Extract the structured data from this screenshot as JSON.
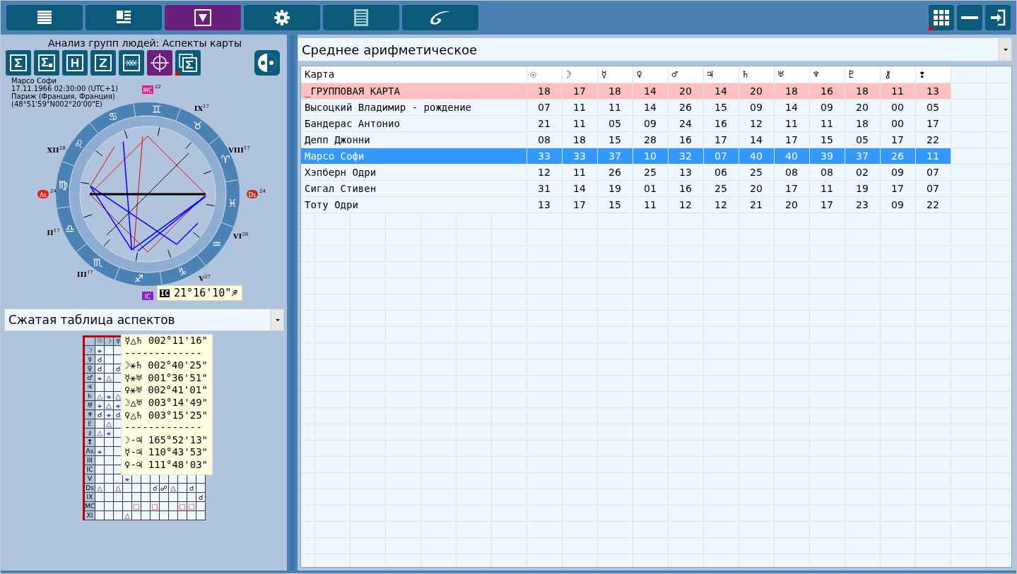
{
  "top_tabs": [
    {
      "selected": false
    },
    {
      "selected": false
    },
    {
      "selected": true
    },
    {
      "selected": false
    },
    {
      "selected": false
    },
    {
      "selected": false
    }
  ],
  "window_buttons": [
    {
      "marked": true
    },
    {
      "marked": false
    },
    {
      "marked": false
    }
  ],
  "left_panel": {
    "title": "Анализ групп людей: Аспекты карты",
    "tools": [
      {
        "selected": false,
        "marked": false
      },
      {
        "selected": false,
        "marked": false
      },
      {
        "selected": false,
        "marked": false
      },
      {
        "selected": false,
        "marked": false
      },
      {
        "selected": false,
        "marked": false
      },
      {
        "selected": true,
        "marked": false
      },
      {
        "selected": false,
        "marked": true
      }
    ],
    "chart": {
      "info": [
        "Марсо Софи",
        "17.11.1966 02:30:00 (UTC+1)",
        "Париж (Франция, Франция)",
        "(48°51'59\"N002°20'00\"E)"
      ],
      "signs": [
        "♊",
        "♉",
        "♈",
        "♓",
        "♒",
        "♑",
        "♐",
        "♏",
        "♎",
        "♍",
        "♌",
        "♋"
      ],
      "houses": [
        {
          "label": "XII",
          "degree": "28"
        },
        {
          "label": "IX",
          "degree": "17"
        },
        {
          "label": "VIII",
          "degree": "17"
        },
        {
          "label": "VI",
          "degree": "28"
        },
        {
          "label": "V",
          "degree": "27"
        },
        {
          "label": "III",
          "degree": "17"
        },
        {
          "label": "II",
          "degree": "17"
        }
      ],
      "angles": [
        {
          "label": "MC",
          "degree": "22"
        },
        {
          "label": "As",
          "degree": "24"
        },
        {
          "label": "Ds",
          "degree": "24"
        },
        {
          "label": "IC"
        }
      ],
      "tooltip": {
        "label": "IC",
        "value": "21°16'10\"♐"
      }
    },
    "view_select": {
      "value": "Сжатая таблица аспектов"
    },
    "aspect_grid": {
      "columns": [
        "☉",
        "☽",
        "☿"
      ],
      "rows": [
        {
          "header": "☽",
          "cells": [
            {
              "kind": "harmonious",
              "glyph": "⚹"
            },
            {
              "kind": "empty"
            },
            {
              "kind": "empty"
            },
            {
              "kind": "empty"
            },
            {
              "kind": "empty"
            },
            {
              "kind": "empty"
            },
            {
              "kind": "empty"
            },
            {
              "kind": "empty"
            },
            {
              "kind": "empty"
            },
            {
              "kind": "empty"
            },
            {
              "kind": "empty"
            },
            {
              "kind": "empty"
            }
          ]
        },
        {
          "header": "☿",
          "cells": [
            {
              "kind": "neutral",
              "glyph": "☌"
            },
            {
              "kind": "empty"
            },
            {
              "kind": "empty"
            },
            {
              "kind": "empty"
            },
            {
              "kind": "empty"
            },
            {
              "kind": "empty"
            },
            {
              "kind": "empty"
            },
            {
              "kind": "empty"
            },
            {
              "kind": "empty"
            },
            {
              "kind": "empty"
            },
            {
              "kind": "empty"
            },
            {
              "kind": "empty"
            }
          ]
        },
        {
          "header": "♀",
          "cells": [
            {
              "kind": "neutral",
              "glyph": "☌"
            },
            {
              "kind": "empty"
            },
            {
              "kind": "neutral",
              "glyph": "☌"
            },
            {
              "kind": "empty"
            },
            {
              "kind": "empty"
            },
            {
              "kind": "empty"
            },
            {
              "kind": "empty"
            },
            {
              "kind": "empty"
            },
            {
              "kind": "empty"
            },
            {
              "kind": "empty"
            },
            {
              "kind": "empty"
            },
            {
              "kind": "empty"
            }
          ]
        },
        {
          "header": "♂",
          "cells": [
            {
              "kind": "harmonious",
              "glyph": "⚹"
            },
            {
              "kind": "harmonious",
              "glyph": "△"
            },
            {
              "kind": "empty"
            },
            {
              "kind": "empty"
            },
            {
              "kind": "empty"
            },
            {
              "kind": "empty"
            },
            {
              "kind": "empty"
            },
            {
              "kind": "empty"
            },
            {
              "kind": "empty"
            },
            {
              "kind": "empty"
            },
            {
              "kind": "empty"
            },
            {
              "kind": "empty"
            }
          ]
        },
        {
          "header": "♃",
          "cells": [
            {
              "kind": "empty"
            },
            {
              "kind": "empty"
            },
            {
              "kind": "empty"
            },
            {
              "kind": "empty"
            },
            {
              "kind": "empty"
            },
            {
              "kind": "empty"
            },
            {
              "kind": "empty"
            },
            {
              "kind": "empty"
            },
            {
              "kind": "empty"
            },
            {
              "kind": "empty"
            },
            {
              "kind": "empty"
            },
            {
              "kind": "empty"
            }
          ]
        },
        {
          "header": "♄",
          "cells": [
            {
              "kind": "harmonious",
              "glyph": "△"
            },
            {
              "kind": "harmonious",
              "glyph": "⚹"
            },
            {
              "kind": "harmonious",
              "glyph": "△"
            },
            {
              "kind": "empty"
            },
            {
              "kind": "empty"
            },
            {
              "kind": "empty"
            },
            {
              "kind": "empty"
            },
            {
              "kind": "empty"
            },
            {
              "kind": "empty"
            },
            {
              "kind": "empty"
            },
            {
              "kind": "empty"
            },
            {
              "kind": "empty"
            }
          ]
        },
        {
          "header": "♅",
          "cells": [
            {
              "kind": "harmonious",
              "glyph": "⚹"
            },
            {
              "kind": "harmonious",
              "glyph": "△"
            },
            {
              "kind": "harmonious",
              "glyph": "⚹"
            },
            {
              "kind": "empty"
            },
            {
              "kind": "empty"
            },
            {
              "kind": "empty"
            },
            {
              "kind": "empty"
            },
            {
              "kind": "empty"
            },
            {
              "kind": "empty"
            },
            {
              "kind": "empty"
            },
            {
              "kind": "empty"
            },
            {
              "kind": "empty"
            }
          ]
        },
        {
          "header": "♆",
          "cells": [
            {
              "kind": "neutral",
              "glyph": "☌"
            },
            {
              "kind": "harmonious",
              "glyph": "⚹"
            },
            {
              "kind": "neutral",
              "glyph": "☌"
            },
            {
              "kind": "empty"
            },
            {
              "kind": "empty"
            },
            {
              "kind": "empty"
            },
            {
              "kind": "empty"
            },
            {
              "kind": "empty"
            },
            {
              "kind": "empty"
            },
            {
              "kind": "empty"
            },
            {
              "kind": "empty"
            },
            {
              "kind": "empty"
            }
          ]
        },
        {
          "header": "♇",
          "cells": [
            {
              "kind": "empty"
            },
            {
              "kind": "harmonious",
              "glyph": "△"
            },
            {
              "kind": "empty"
            },
            {
              "kind": "empty"
            },
            {
              "kind": "empty"
            },
            {
              "kind": "empty"
            },
            {
              "kind": "empty"
            },
            {
              "kind": "empty"
            },
            {
              "kind": "empty"
            },
            {
              "kind": "empty"
            },
            {
              "kind": "empty"
            },
            {
              "kind": "empty"
            }
          ]
        },
        {
          "header": "⚷",
          "cells": [
            {
              "kind": "harmonious",
              "glyph": "△"
            },
            {
              "kind": "harmonious",
              "glyph": "⚹"
            },
            {
              "kind": "empty"
            },
            {
              "kind": "empty"
            },
            {
              "kind": "empty"
            },
            {
              "kind": "empty"
            },
            {
              "kind": "empty"
            },
            {
              "kind": "empty"
            },
            {
              "kind": "empty"
            },
            {
              "kind": "empty"
            },
            {
              "kind": "empty"
            },
            {
              "kind": "empty"
            }
          ]
        },
        {
          "header": "❢",
          "cells": [
            {
              "kind": "empty"
            },
            {
              "kind": "empty"
            },
            {
              "kind": "empty"
            },
            {
              "kind": "empty"
            },
            {
              "kind": "empty"
            },
            {
              "kind": "empty"
            },
            {
              "kind": "empty"
            },
            {
              "kind": "empty"
            },
            {
              "kind": "empty"
            },
            {
              "kind": "empty"
            },
            {
              "kind": "empty"
            },
            {
              "kind": "empty"
            }
          ]
        },
        {
          "header": "As",
          "cells": [
            {
              "kind": "harmonious",
              "glyph": "⚹"
            },
            {
              "kind": "empty"
            },
            {
              "kind": "empty"
            },
            {
              "kind": "empty"
            },
            {
              "kind": "empty"
            },
            {
              "kind": "empty"
            },
            {
              "kind": "empty"
            },
            {
              "kind": "empty"
            },
            {
              "kind": "empty"
            },
            {
              "kind": "empty"
            },
            {
              "kind": "empty"
            },
            {
              "kind": "empty"
            }
          ]
        },
        {
          "header": "III",
          "cells": [
            {
              "kind": "empty"
            },
            {
              "kind": "empty"
            },
            {
              "kind": "empty"
            },
            {
              "kind": "empty"
            },
            {
              "kind": "empty"
            },
            {
              "kind": "empty"
            },
            {
              "kind": "empty"
            },
            {
              "kind": "empty"
            },
            {
              "kind": "empty"
            },
            {
              "kind": "empty"
            },
            {
              "kind": "empty"
            },
            {
              "kind": "empty"
            }
          ]
        },
        {
          "header": "IC",
          "cells": [
            {
              "kind": "empty"
            },
            {
              "kind": "empty"
            },
            {
              "kind": "empty"
            },
            {
              "kind": "empty"
            },
            {
              "kind": "empty"
            },
            {
              "kind": "empty"
            },
            {
              "kind": "empty"
            },
            {
              "kind": "empty"
            },
            {
              "kind": "empty"
            },
            {
              "kind": "empty"
            },
            {
              "kind": "empty"
            },
            {
              "kind": "empty"
            }
          ]
        },
        {
          "header": "V",
          "cells": [
            {
              "kind": "empty"
            },
            {
              "kind": "empty"
            },
            {
              "kind": "empty"
            },
            {
              "kind": "harmonious",
              "glyph": "⚹"
            },
            {
              "kind": "empty"
            },
            {
              "kind": "empty"
            },
            {
              "kind": "empty"
            },
            {
              "kind": "empty"
            },
            {
              "kind": "empty"
            },
            {
              "kind": "empty"
            },
            {
              "kind": "empty"
            },
            {
              "kind": "empty"
            }
          ]
        },
        {
          "header": "Ds",
          "cells": [
            {
              "kind": "harmonious",
              "glyph": "△"
            },
            {
              "kind": "empty"
            },
            {
              "kind": "harmonious",
              "glyph": "△"
            },
            {
              "kind": "empty"
            },
            {
              "kind": "empty"
            },
            {
              "kind": "empty"
            },
            {
              "kind": "neutral",
              "glyph": "☌"
            },
            {
              "kind": "neutral",
              "glyph": "☍"
            },
            {
              "kind": "harmonious",
              "glyph": "△"
            },
            {
              "kind": "empty"
            },
            {
              "kind": "neutral",
              "glyph": "☌"
            },
            {
              "kind": "empty"
            }
          ]
        },
        {
          "header": "IX",
          "cells": [
            {
              "kind": "empty"
            },
            {
              "kind": "empty"
            },
            {
              "kind": "empty"
            },
            {
              "kind": "empty"
            },
            {
              "kind": "empty"
            },
            {
              "kind": "empty"
            },
            {
              "kind": "empty"
            },
            {
              "kind": "empty"
            },
            {
              "kind": "empty"
            },
            {
              "kind": "empty"
            },
            {
              "kind": "empty"
            },
            {
              "kind": "neutral",
              "glyph": "☌"
            }
          ]
        },
        {
          "header": "MC",
          "cells": [
            {
              "kind": "empty"
            },
            {
              "kind": "empty"
            },
            {
              "kind": "empty"
            },
            {
              "kind": "empty"
            },
            {
              "kind": "tense",
              "glyph": "□"
            },
            {
              "kind": "empty"
            },
            {
              "kind": "tense",
              "glyph": "□"
            },
            {
              "kind": "empty"
            },
            {
              "kind": "empty"
            },
            {
              "kind": "tense",
              "glyph": "□"
            },
            {
              "kind": "tense",
              "glyph": "□"
            },
            {
              "kind": "empty"
            }
          ]
        },
        {
          "header": "XI",
          "cells": [
            {
              "kind": "empty"
            },
            {
              "kind": "empty"
            },
            {
              "kind": "empty"
            },
            {
              "kind": "harmonious",
              "glyph": "△"
            },
            {
              "kind": "empty"
            },
            {
              "kind": "empty"
            },
            {
              "kind": "empty"
            },
            {
              "kind": "empty"
            },
            {
              "kind": "empty"
            },
            {
              "kind": "empty"
            },
            {
              "kind": "empty"
            },
            {
              "kind": "empty"
            }
          ]
        }
      ],
      "tooltip": [
        "☿△♄ 002°11'16\"",
        "-------------",
        "☽⚹♄ 002°40'25\"",
        "☿⚹♅ 001°36'51\"",
        "♀⚹♅ 002°41'01\"",
        "☽△♅ 003°14'49\"",
        "♀△♄ 003°15'25\"",
        "-------------",
        "☽-♃ 165°52'13\"",
        "☿-♃ 110°43'53\"",
        "♀-♃ 111°48'03\""
      ]
    }
  },
  "mode_select": {
    "value": "Среднее арифметическое"
  },
  "table": {
    "columns": [
      "Карта",
      "☉",
      "☽",
      "☿",
      "♀",
      "♂",
      "♃",
      "♄",
      "♅",
      "♆",
      "♇",
      "⚷",
      "❢"
    ],
    "rows": [
      {
        "kind": "group",
        "selected": false,
        "cells": [
          "_ГРУППОВАЯ КАРТА",
          "18",
          "17",
          "18",
          "14",
          "20",
          "14",
          "20",
          "18",
          "16",
          "18",
          "11",
          "13"
        ]
      },
      {
        "kind": "person",
        "selected": false,
        "cells": [
          "Высоцкий Владимир - рождение",
          "07",
          "11",
          "11",
          "14",
          "26",
          "15",
          "09",
          "14",
          "09",
          "20",
          "00",
          "05"
        ]
      },
      {
        "kind": "person",
        "selected": false,
        "cells": [
          "Бандерас Антонио",
          "21",
          "11",
          "05",
          "09",
          "24",
          "16",
          "12",
          "11",
          "11",
          "18",
          "00",
          "17"
        ]
      },
      {
        "kind": "person",
        "selected": false,
        "cells": [
          "Депп Джонни",
          "08",
          "18",
          "15",
          "28",
          "16",
          "17",
          "14",
          "17",
          "15",
          "05",
          "17",
          "22"
        ]
      },
      {
        "kind": "person",
        "selected": true,
        "cells": [
          "Марсо Софи",
          "33",
          "33",
          "37",
          "10",
          "32",
          "07",
          "40",
          "40",
          "39",
          "37",
          "26",
          "11"
        ]
      },
      {
        "kind": "person",
        "selected": false,
        "cells": [
          "Хэпберн Одри",
          "12",
          "11",
          "26",
          "25",
          "13",
          "06",
          "25",
          "08",
          "08",
          "02",
          "09",
          "07"
        ]
      },
      {
        "kind": "person",
        "selected": false,
        "cells": [
          "Сигал Стивен",
          "31",
          "14",
          "19",
          "01",
          "16",
          "25",
          "20",
          "17",
          "11",
          "19",
          "17",
          "07"
        ]
      },
      {
        "kind": "person",
        "selected": false,
        "cells": [
          "Тоту Одри",
          "13",
          "17",
          "15",
          "11",
          "12",
          "12",
          "21",
          "20",
          "17",
          "23",
          "09",
          "22"
        ]
      }
    ]
  }
}
